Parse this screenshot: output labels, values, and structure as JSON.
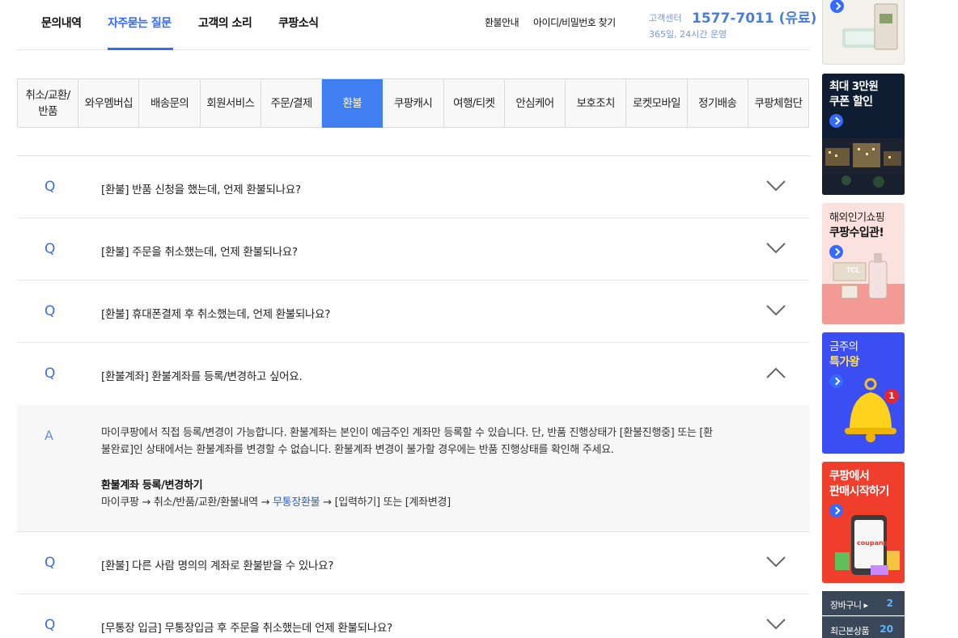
{
  "topnav": {
    "tabs": [
      {
        "label": "문의내역"
      },
      {
        "label": "자주묻는 질문"
      },
      {
        "label": "고객의 소리"
      },
      {
        "label": "쿠팡소식"
      }
    ],
    "active_tab": "자주묻는 질문",
    "util_links": [
      "환불안내",
      "아이디/비밀번호 찾기"
    ],
    "cs_label": "고객센터",
    "cs_phone": "1577-7011 (유료)",
    "cs_hours": "365일, 24시간 운영"
  },
  "categories": [
    "취소/교환/반품",
    "와우멤버십",
    "배송문의",
    "회원서비스",
    "주문/결제",
    "환불",
    "쿠팡캐시",
    "여행/티켓",
    "안심케어",
    "보호조치",
    "로켓모바일",
    "정기배송",
    "쿠팡체험단"
  ],
  "active_category": "환불",
  "faq": {
    "q_marker": "Q",
    "a_marker": "A",
    "items": [
      {
        "question": "[환불] 반품 신청을 했는데, 언제 환불되나요?"
      },
      {
        "question": "[환불] 주문을 취소했는데, 언제 환불되나요?"
      },
      {
        "question": "[환불] 휴대폰결제 후 취소했는데, 언제 환불되나요?"
      },
      {
        "question": "[환불계좌] 환불계좌를 등록/변경하고 싶어요."
      },
      {
        "question": "[환불] 다른 사람 명의의 계좌로 환불받을 수 있나요?"
      },
      {
        "question": "[무통장 입금] 무통장입금 후 주문을 취소했는데 언제 환불되나요?"
      }
    ],
    "expanded_index": 3,
    "answer": {
      "line1": "마이쿠팡에서 직접 등록/변경이 가능합니다. 환불계좌는 본인이 예금주인 계좌만 등록할 수 있습니다. 단, 반품 진행상태가 [환불진행중] 또는 [환",
      "line2": "불완료]인 상태에서는 환불계좌를 변경할 수 없습니다. 환불계좌 변경이 불가할 경우에는 반품 진행상태를 확인해 주세요.",
      "subtitle": "환불계좌 등록/변경하기",
      "path_prefix": "마이쿠팡 → 취소/반품/교환/환불내역 → ",
      "path_link": "무통장환불",
      "path_suffix": " → [입력하기] 또는 [계좌변경]"
    }
  },
  "banners": [
    {
      "t1": "",
      "t2": "",
      "icon": "product-photo"
    },
    {
      "t1": "최대 3만원",
      "t2": "쿠폰 할인",
      "icon": "night-city-photo"
    },
    {
      "t1": "해외인기쇼핑",
      "t2": "쿠팡수입관!",
      "icon": "import-goods-photo"
    },
    {
      "t1": "금주의",
      "t2": "특가왕",
      "icon": "bell-icon",
      "badge": "1"
    },
    {
      "t1": "쿠팡에서",
      "t2": "판매시작하기",
      "icon": "phone-shop-photo",
      "logo": "coupang"
    }
  ],
  "mini_panel": [
    {
      "label": "장바구니 ▸",
      "count": "2"
    },
    {
      "label": "최근본상품",
      "count": "20"
    }
  ],
  "colors": {
    "accent": "#346aff",
    "category_active": "#3f7ff2"
  }
}
